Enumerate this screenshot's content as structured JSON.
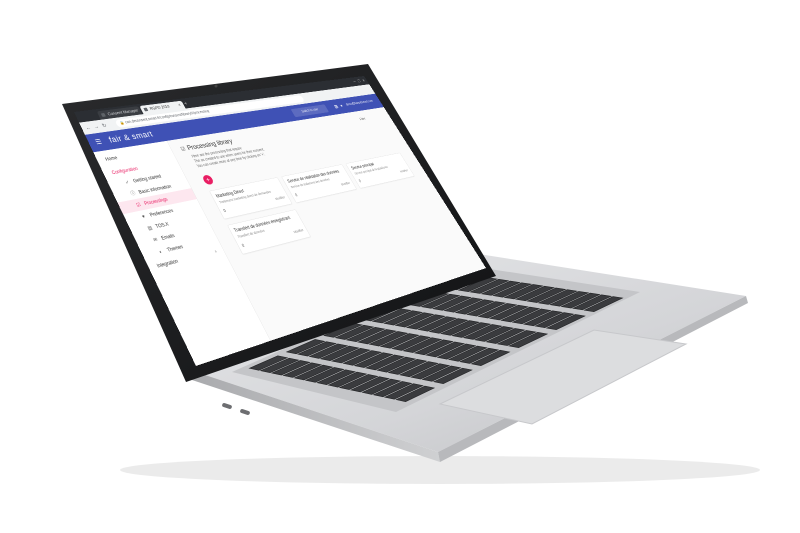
{
  "browser": {
    "tabs": [
      {
        "label": "Consent Manager",
        "active": false
      },
      {
        "label": "RGPD 2019 CONSENTEMENT",
        "active": true
      }
    ],
    "address": "con.deconsent.smart.fr/config/consent/library/#/processing"
  },
  "app": {
    "brand": "fair & smart",
    "switch_label": "Switch to user",
    "user_email": "demo@fairandsmart.com"
  },
  "sidebar": {
    "home": "Home",
    "section": "Configuration",
    "items": [
      {
        "label": "Getting started",
        "icon": "check-icon"
      },
      {
        "label": "Basic information",
        "icon": "info-icon"
      },
      {
        "label": "Processings",
        "icon": "checkbox-icon",
        "active": true
      },
      {
        "label": "Preferences",
        "icon": "heart-icon"
      },
      {
        "label": "TOS.X",
        "icon": "document-icon"
      },
      {
        "label": "Emails",
        "icon": "mail-icon"
      },
      {
        "label": "Themes",
        "icon": "palette-icon"
      }
    ],
    "integration": "Integration"
  },
  "main": {
    "title": "Processing library",
    "description": [
      "Here are the processing that require",
      "The as created to use when users for their consent.",
      "You can create more at any time by clicking on '+'."
    ],
    "filter_label": "Filter",
    "add_label": "+",
    "cards": [
      {
        "title": "Marketing Direct",
        "desc": "Traitement marketing direct de demandes",
        "footer": "0",
        "action": "Modifier"
      },
      {
        "title": "Service de réalisation des données",
        "desc": "Service de traitement des données",
        "footer": "0",
        "action": "Modifier"
      },
      {
        "title": "Service principal",
        "desc": "Service principal de la plateforme",
        "footer": "0",
        "action": "Modifier"
      },
      {
        "title": "Transfert de données enregistrant",
        "desc": "Transfert de données",
        "footer": "0",
        "action": "Modifier"
      }
    ]
  },
  "colors": {
    "appbar": "#3f51b5",
    "accent": "#e91e63",
    "laptop_body": "#d8d9db"
  }
}
